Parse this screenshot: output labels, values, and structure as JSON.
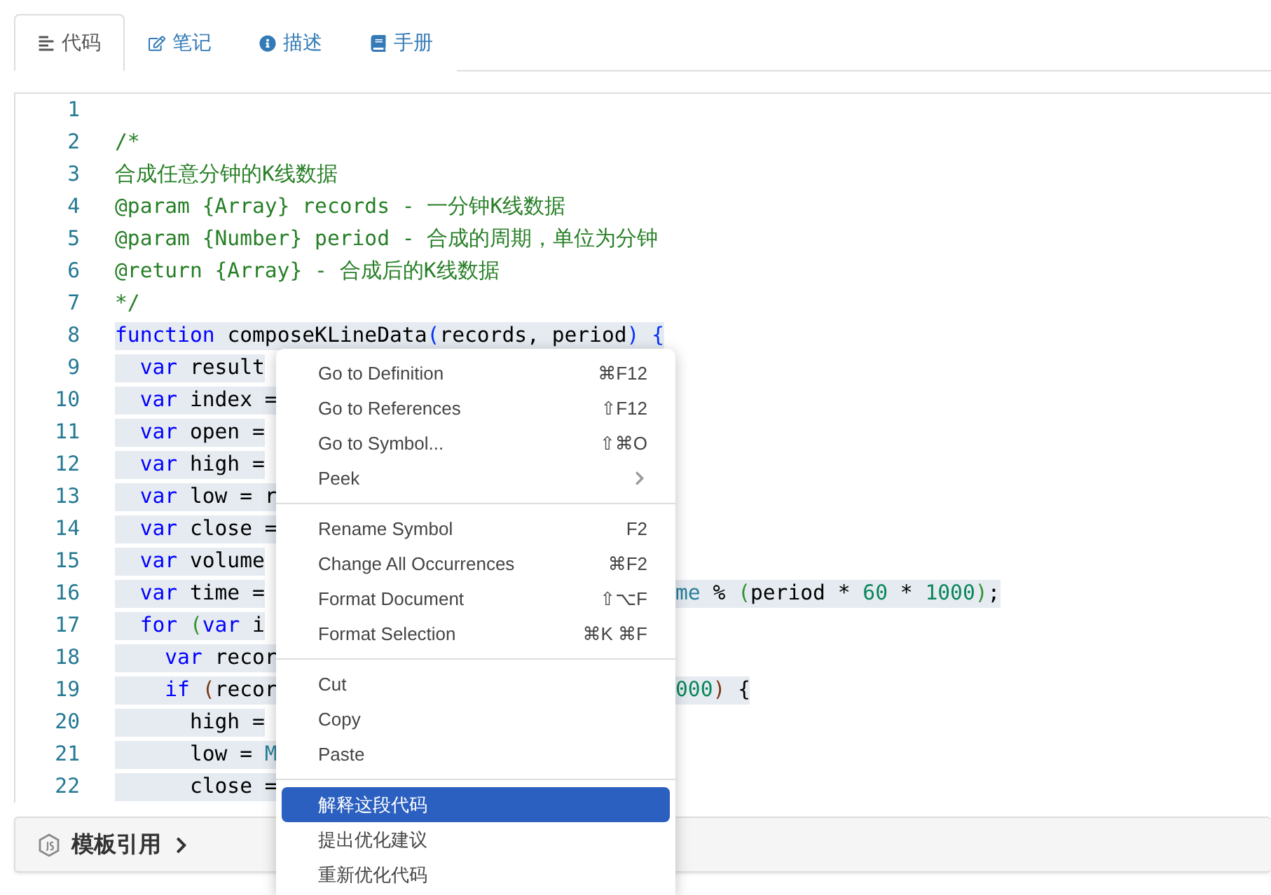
{
  "tabs": [
    {
      "label": "代码",
      "selected": true
    },
    {
      "label": "笔记",
      "selected": false
    },
    {
      "label": "描述",
      "selected": false
    },
    {
      "label": "手册",
      "selected": false
    }
  ],
  "editor": {
    "lines": [
      {
        "number": "1"
      },
      {
        "number": "2",
        "selected": false,
        "left": [
          {
            "text": "/*",
            "kind": "comment"
          }
        ]
      },
      {
        "number": "3",
        "selected": false,
        "left": [
          {
            "text": "合成任意分钟的K线数据",
            "kind": "comment"
          }
        ]
      },
      {
        "number": "4",
        "selected": false,
        "left": [
          {
            "text": "@param {Array} records - 一分钟K线数据",
            "kind": "comment"
          }
        ]
      },
      {
        "number": "5",
        "selected": false,
        "left": [
          {
            "text": "@param {Number} period - 合成的周期，单位为分钟",
            "kind": "comment"
          }
        ]
      },
      {
        "number": "6",
        "selected": false,
        "left": [
          {
            "text": "@return {Array} - 合成后的K线数据",
            "kind": "comment"
          }
        ]
      },
      {
        "number": "7",
        "selected": false,
        "left": [
          {
            "text": "*/",
            "kind": "comment"
          }
        ]
      },
      {
        "number": "8",
        "selected": true,
        "left": [
          {
            "text": "function",
            "kind": "keyword"
          },
          {
            "text": " composeKLineData",
            "kind": "plain"
          },
          {
            "text": "(",
            "kind": "bracket"
          },
          {
            "text": "records, period",
            "kind": "plain"
          },
          {
            "text": ")",
            "kind": "bracket"
          },
          {
            "text": " {",
            "kind": "bracket"
          }
        ]
      },
      {
        "number": "9",
        "selected": true,
        "left": [
          {
            "text": "  var",
            "kind": "keyword"
          },
          {
            "text": " result",
            "kind": "plain"
          }
        ]
      },
      {
        "number": "10",
        "selected": true,
        "left": [
          {
            "text": "  var",
            "kind": "keyword"
          },
          {
            "text": " index =",
            "kind": "plain"
          }
        ]
      },
      {
        "number": "11",
        "selected": true,
        "left": [
          {
            "text": "  var",
            "kind": "keyword"
          },
          {
            "text": " open =",
            "kind": "plain"
          }
        ]
      },
      {
        "number": "12",
        "selected": true,
        "left": [
          {
            "text": "  var",
            "kind": "keyword"
          },
          {
            "text": " high =",
            "kind": "plain"
          }
        ]
      },
      {
        "number": "13",
        "selected": true,
        "left": [
          {
            "text": "  var",
            "kind": "keyword"
          },
          {
            "text": " low = r",
            "kind": "plain"
          }
        ]
      },
      {
        "number": "14",
        "selected": true,
        "left": [
          {
            "text": "  var",
            "kind": "keyword"
          },
          {
            "text": " close =",
            "kind": "plain"
          }
        ]
      },
      {
        "number": "15",
        "selected": true,
        "left": [
          {
            "text": "  var",
            "kind": "keyword"
          },
          {
            "text": " volume",
            "kind": "plain"
          }
        ]
      },
      {
        "number": "16",
        "selected": true,
        "left": [
          {
            "text": "  var",
            "kind": "keyword"
          },
          {
            "text": " time =",
            "kind": "plain"
          }
        ],
        "right": [
          {
            "text": "me",
            "kind": "type"
          },
          {
            "text": " % ",
            "kind": "plain"
          },
          {
            "text": "(",
            "kind": "paren"
          },
          {
            "text": "period * ",
            "kind": "plain"
          },
          {
            "text": "60",
            "kind": "number"
          },
          {
            "text": " * ",
            "kind": "plain"
          },
          {
            "text": "1000",
            "kind": "number"
          },
          {
            "text": ")",
            "kind": "paren"
          },
          {
            "text": ";",
            "kind": "plain"
          }
        ]
      },
      {
        "number": "17",
        "selected": true,
        "left": [
          {
            "text": "  for",
            "kind": "keyword"
          },
          {
            "text": " (",
            "kind": "paren"
          },
          {
            "text": "var",
            "kind": "keyword"
          },
          {
            "text": " i",
            "kind": "plain"
          }
        ]
      },
      {
        "number": "18",
        "selected": true,
        "left": [
          {
            "text": "    var",
            "kind": "keyword"
          },
          {
            "text": " recor",
            "kind": "plain"
          }
        ]
      },
      {
        "number": "19",
        "selected": true,
        "left": [
          {
            "text": "    if",
            "kind": "keyword"
          },
          {
            "text": " (",
            "kind": "brace"
          },
          {
            "text": "recor",
            "kind": "plain"
          }
        ],
        "right": [
          {
            "text": "000",
            "kind": "number"
          },
          {
            "text": ")",
            "kind": "brace"
          },
          {
            "text": " {",
            "kind": "plain"
          }
        ]
      },
      {
        "number": "20",
        "selected": true,
        "left": [
          {
            "text": "      high =",
            "kind": "plain"
          }
        ]
      },
      {
        "number": "21",
        "selected": true,
        "left": [
          {
            "text": "      low = ",
            "kind": "plain"
          },
          {
            "text": "M",
            "kind": "type"
          }
        ]
      },
      {
        "number": "22",
        "selected": true,
        "left": [
          {
            "text": "      close =",
            "kind": "plain"
          }
        ]
      }
    ]
  },
  "footer": {
    "label": "模板引用"
  },
  "context_menu": {
    "groups": [
      [
        {
          "label": "Go to Definition",
          "shortcut": "⌘F12",
          "selected": false
        },
        {
          "label": "Go to References",
          "shortcut": "⇧F12",
          "selected": false
        },
        {
          "label": "Go to Symbol...",
          "shortcut": "⇧⌘O",
          "selected": false
        },
        {
          "label": "Peek",
          "submenu": true,
          "selected": false
        }
      ],
      [
        {
          "label": "Rename Symbol",
          "shortcut": "F2",
          "selected": false
        },
        {
          "label": "Change All Occurrences",
          "shortcut": "⌘F2",
          "selected": false
        },
        {
          "label": "Format Document",
          "shortcut": "⇧⌥F",
          "selected": false
        },
        {
          "label": "Format Selection",
          "shortcut": "⌘K ⌘F",
          "selected": false
        }
      ],
      [
        {
          "label": "Cut",
          "selected": false
        },
        {
          "label": "Copy",
          "selected": false
        },
        {
          "label": "Paste",
          "selected": false
        }
      ],
      [
        {
          "label": "解释这段代码",
          "selected": true
        },
        {
          "label": "提出优化建议",
          "selected": false
        },
        {
          "label": "重新优化代码",
          "selected": false
        }
      ]
    ]
  }
}
